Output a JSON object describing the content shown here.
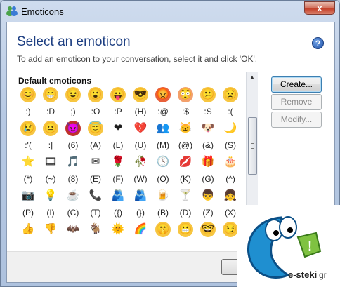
{
  "window": {
    "title": "Emoticons",
    "close_glyph": "x"
  },
  "header": {
    "title": "Select an emoticon",
    "subtitle": "To add an emoticon to your conversation, select it and click 'OK'.",
    "help_glyph": "?"
  },
  "gallery": {
    "section_label": "Default emoticons",
    "rows": [
      [
        {
          "code": ":)",
          "icon": "smile-icon",
          "glyph": "😊",
          "color": "#f7c641"
        },
        {
          "code": ":D",
          "icon": "big-grin-icon",
          "glyph": "😁",
          "color": "#f7c641"
        },
        {
          "code": ";)",
          "icon": "wink-icon",
          "glyph": "😉",
          "color": "#f7c641"
        },
        {
          "code": ":O",
          "icon": "surprised-icon",
          "glyph": "😮",
          "color": "#f7c641"
        },
        {
          "code": ":P",
          "icon": "tongue-icon",
          "glyph": "😛",
          "color": "#f7c641"
        },
        {
          "code": "(H)",
          "icon": "hot-icon",
          "glyph": "😎",
          "color": "#f7c641"
        },
        {
          "code": ":@",
          "icon": "angry-icon",
          "glyph": "😡",
          "color": "#e8603a"
        },
        {
          "code": ":$",
          "icon": "embarrassed-icon",
          "glyph": "😳",
          "color": "#f3a06b"
        },
        {
          "code": ":S",
          "icon": "confused-icon",
          "glyph": "😕",
          "color": "#f7c641"
        },
        {
          "code": ":(",
          "icon": "sad-icon",
          "glyph": "😟",
          "color": "#f7c641"
        }
      ],
      [
        {
          "code": ":'(",
          "icon": "crying-icon",
          "glyph": "😢",
          "color": "#f7c641"
        },
        {
          "code": ":|",
          "icon": "disappointed-icon",
          "glyph": "😐",
          "color": "#f7c641"
        },
        {
          "code": "(6)",
          "icon": "devil-icon",
          "glyph": "😈",
          "color": "#c0312b"
        },
        {
          "code": "(A)",
          "icon": "angel-icon",
          "glyph": "😇",
          "color": "#f7c641"
        },
        {
          "code": "(L)",
          "icon": "red-heart-icon",
          "glyph": "❤",
          "color": "#ffffff"
        },
        {
          "code": "(U)",
          "icon": "broken-heart-icon",
          "glyph": "💔",
          "color": "#ffffff"
        },
        {
          "code": "(M)",
          "icon": "messenger-icon",
          "glyph": "👥",
          "color": "#ffffff"
        },
        {
          "code": "(@)",
          "icon": "cat-icon",
          "glyph": "🐱",
          "color": "#ffffff"
        },
        {
          "code": "(&)",
          "icon": "dog-icon",
          "glyph": "🐶",
          "color": "#ffffff"
        },
        {
          "code": "(S)",
          "icon": "moon-icon",
          "glyph": "🌙",
          "color": "#ffffff"
        }
      ],
      [
        {
          "code": "(*)",
          "icon": "star-icon",
          "glyph": "⭐",
          "color": "#ffffff"
        },
        {
          "code": "(~)",
          "icon": "film-icon",
          "glyph": "🎞",
          "color": "#ffffff"
        },
        {
          "code": "(8)",
          "icon": "note-icon",
          "glyph": "🎵",
          "color": "#ffffff"
        },
        {
          "code": "(E)",
          "icon": "email-icon",
          "glyph": "✉",
          "color": "#ffffff"
        },
        {
          "code": "(F)",
          "icon": "rose-icon",
          "glyph": "🌹",
          "color": "#ffffff"
        },
        {
          "code": "(W)",
          "icon": "wilted-rose-icon",
          "glyph": "🥀",
          "color": "#ffffff"
        },
        {
          "code": "(O)",
          "icon": "clock-icon",
          "glyph": "🕓",
          "color": "#ffffff"
        },
        {
          "code": "(K)",
          "icon": "kiss-icon",
          "glyph": "💋",
          "color": "#ffffff"
        },
        {
          "code": "(G)",
          "icon": "gift-icon",
          "glyph": "🎁",
          "color": "#ffffff"
        },
        {
          "code": "(^)",
          "icon": "cake-icon",
          "glyph": "🎂",
          "color": "#ffffff"
        }
      ],
      [
        {
          "code": "(P)",
          "icon": "camera-icon",
          "glyph": "📷",
          "color": "#ffffff"
        },
        {
          "code": "(I)",
          "icon": "light-bulb-icon",
          "glyph": "💡",
          "color": "#ffffff"
        },
        {
          "code": "(C)",
          "icon": "coffee-icon",
          "glyph": "☕",
          "color": "#ffffff"
        },
        {
          "code": "(T)",
          "icon": "phone-icon",
          "glyph": "📞",
          "color": "#ffffff"
        },
        {
          "code": "({)",
          "icon": "left-hug-icon",
          "glyph": "🫂",
          "color": "#ffffff"
        },
        {
          "code": "(})",
          "icon": "right-hug-icon",
          "glyph": "🫂",
          "color": "#ffffff"
        },
        {
          "code": "(B)",
          "icon": "beer-icon",
          "glyph": "🍺",
          "color": "#ffffff"
        },
        {
          "code": "(D)",
          "icon": "martini-icon",
          "glyph": "🍸",
          "color": "#ffffff"
        },
        {
          "code": "(Z)",
          "icon": "boy-icon",
          "glyph": "👦",
          "color": "#ffffff"
        },
        {
          "code": "(X)",
          "icon": "girl-icon",
          "glyph": "👧",
          "color": "#ffffff"
        }
      ],
      [
        {
          "code": "",
          "icon": "thumbs-up-icon",
          "glyph": "👍",
          "color": "#ffffff"
        },
        {
          "code": "",
          "icon": "thumbs-down-icon",
          "glyph": "👎",
          "color": "#ffffff"
        },
        {
          "code": "",
          "icon": "vampire-bat-icon",
          "glyph": "🦇",
          "color": "#ffffff"
        },
        {
          "code": "",
          "icon": "goat-icon",
          "glyph": "🐐",
          "color": "#ffffff"
        },
        {
          "code": "",
          "icon": "sun-icon",
          "glyph": "🌞",
          "color": "#ffffff"
        },
        {
          "code": "",
          "icon": "rainbow-icon",
          "glyph": "🌈",
          "color": "#ffffff"
        },
        {
          "code": "",
          "icon": "dont-tell-icon",
          "glyph": "🤫",
          "color": "#f7c641"
        },
        {
          "code": "",
          "icon": "baring-teeth-icon",
          "glyph": "😬",
          "color": "#f7c641"
        },
        {
          "code": "",
          "icon": "nerd-icon",
          "glyph": "🤓",
          "color": "#f7c641"
        },
        {
          "code": "",
          "icon": "sarcastic-icon",
          "glyph": "😏",
          "color": "#f7c641"
        }
      ]
    ]
  },
  "buttons": {
    "create": "Create...",
    "remove": "Remove",
    "modify": "Modify..."
  },
  "logo": {
    "text": "e-steki",
    "tld": "gr"
  }
}
